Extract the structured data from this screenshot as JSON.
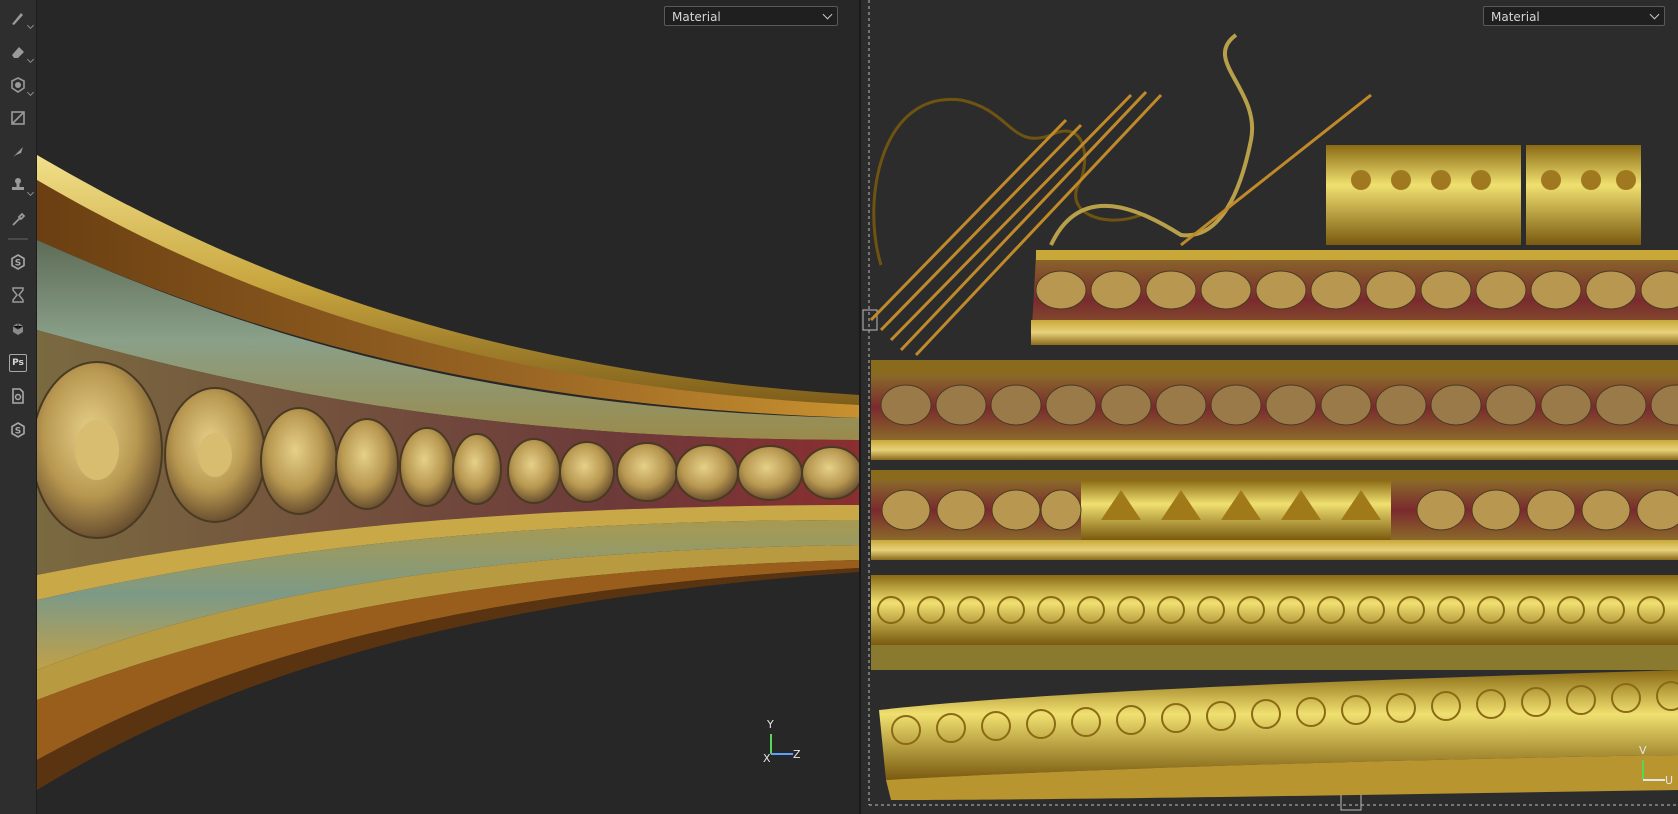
{
  "toolbar": {
    "tools": [
      {
        "icon": "paint-brush-icon"
      },
      {
        "icon": "eraser-icon"
      },
      {
        "icon": "projection-icon"
      },
      {
        "icon": "polygon-fill-icon"
      },
      {
        "icon": "smudge-icon"
      },
      {
        "icon": "clone-stamp-icon"
      },
      {
        "icon": "color-picker-icon"
      },
      {
        "icon": "substance-link-icon"
      },
      {
        "icon": "bake-hourglass-icon"
      },
      {
        "icon": "substance-cube-icon"
      },
      {
        "icon": "photoshop-icon",
        "label": "Ps"
      },
      {
        "icon": "export-document-icon"
      },
      {
        "icon": "substance-source-icon"
      }
    ]
  },
  "viewport_3d": {
    "display_mode": "Material",
    "gizmo": {
      "y": "Y",
      "x": "X",
      "z": "Z"
    }
  },
  "viewport_2d": {
    "display_mode": "Material",
    "gizmo": {
      "y": "V",
      "u": "U"
    }
  },
  "colors": {
    "gold_light": "#e8d27a",
    "gold_mid": "#b8952f",
    "gold_dark": "#6e5410",
    "bronze": "#8a5a1c",
    "crimson": "#7a2a2e",
    "patina": "#7d9a86"
  }
}
